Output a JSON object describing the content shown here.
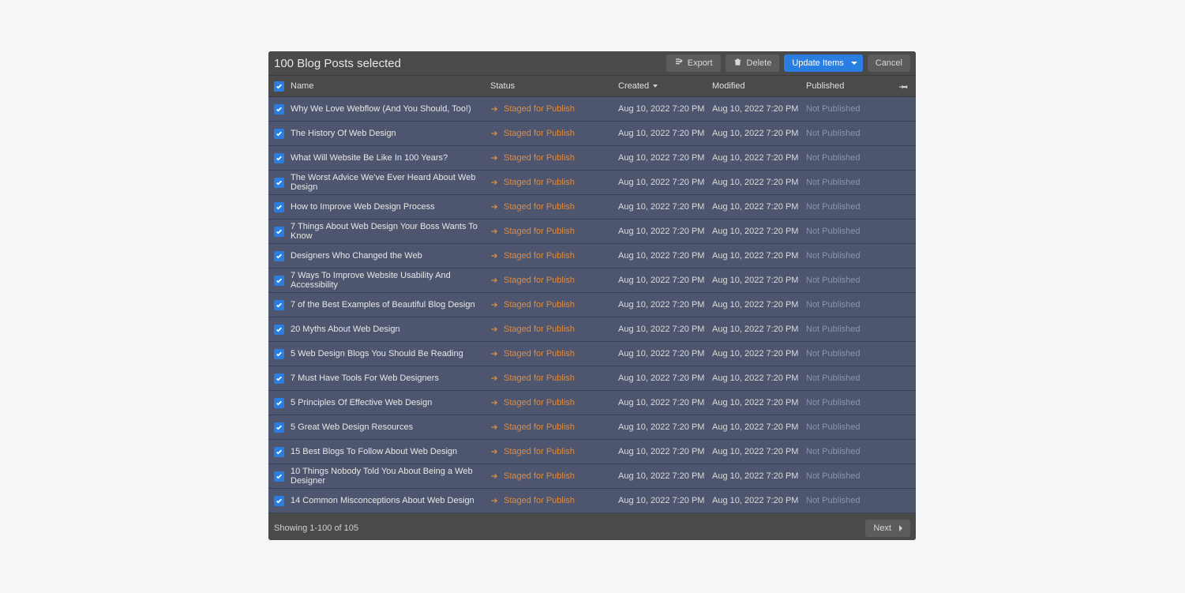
{
  "toolbar": {
    "title": "100 Blog Posts selected",
    "export_label": "Export",
    "delete_label": "Delete",
    "update_label": "Update Items",
    "cancel_label": "Cancel"
  },
  "columns": {
    "name": "Name",
    "status": "Status",
    "created": "Created",
    "modified": "Modified",
    "published": "Published"
  },
  "status_text": "Staged for Publish",
  "not_published_text": "Not Published",
  "timestamp": "Aug 10, 2022 7:20 PM",
  "rows": [
    {
      "name": "Why We Love Webflow (And You Should, Too!)"
    },
    {
      "name": "The History Of Web Design"
    },
    {
      "name": "What Will Website Be Like In 100 Years?"
    },
    {
      "name": "The Worst Advice We've Ever Heard About Web Design"
    },
    {
      "name": "How to Improve Web Design Process"
    },
    {
      "name": "7 Things About Web Design Your Boss Wants To Know"
    },
    {
      "name": "Designers Who Changed the Web"
    },
    {
      "name": "7 Ways To Improve Website Usability And Accessibility"
    },
    {
      "name": "7 of the Best Examples of Beautiful Blog Design"
    },
    {
      "name": "20 Myths About Web Design"
    },
    {
      "name": "5 Web Design Blogs You Should Be Reading"
    },
    {
      "name": "7 Must Have Tools For Web Designers"
    },
    {
      "name": "5 Principles Of Effective Web Design"
    },
    {
      "name": "5 Great Web Design Resources"
    },
    {
      "name": "15 Best Blogs To Follow About Web Design"
    },
    {
      "name": "10 Things Nobody Told You About Being a Web Designer"
    },
    {
      "name": "14 Common Misconceptions About Web Design"
    }
  ],
  "footer": {
    "showing": "Showing 1-100 of 105",
    "next": "Next"
  }
}
